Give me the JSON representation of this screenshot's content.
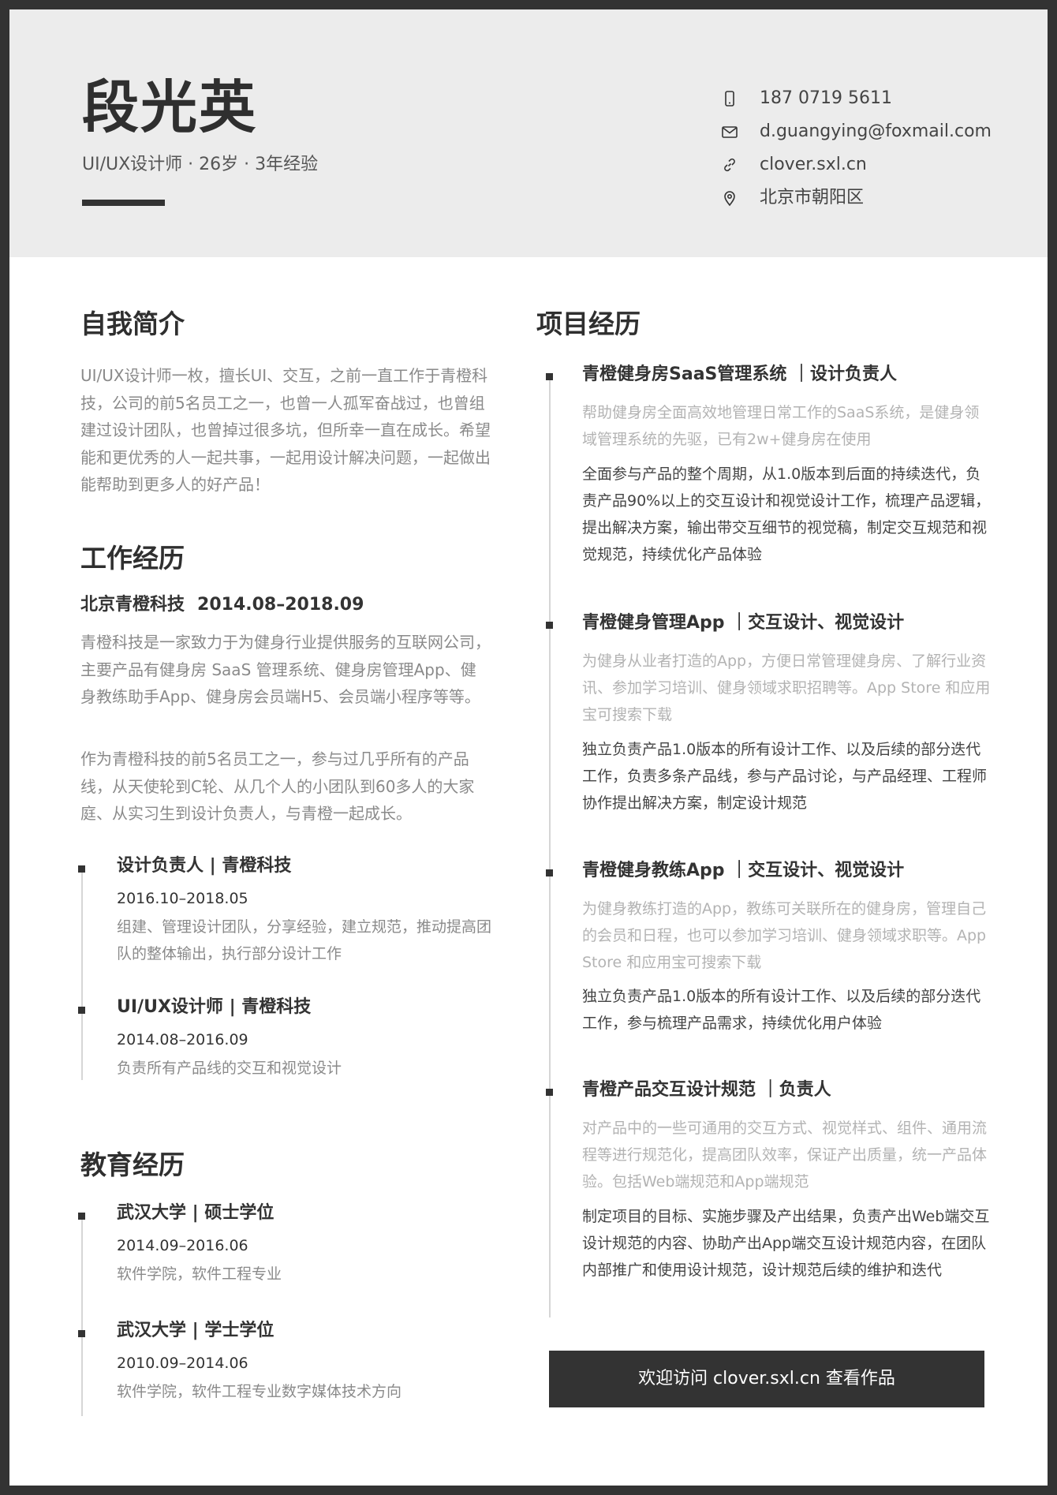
{
  "header": {
    "name": "段光英",
    "subtitle": "UI/UX设计师 · 26岁 · 3年经验",
    "contacts": [
      {
        "icon": "phone-icon",
        "text": "187 0719 5611"
      },
      {
        "icon": "mail-icon",
        "text": "d.guangying@foxmail.com"
      },
      {
        "icon": "link-icon",
        "text": "clover.sxl.cn"
      },
      {
        "icon": "location-icon",
        "text": "北京市朝阳区"
      }
    ]
  },
  "intro": {
    "title": "自我简介",
    "text": "UI/UX设计师一枚，擅长UI、交互，之前一直工作于青橙科技，公司的前5名员工之一，也曾一人孤军奋战过，也曾组建过设计团队，也曾掉过很多坑，但所幸一直在成长。希望能和更优秀的人一起共事，一起用设计解决问题，一起做出能帮助到更多人的好产品！"
  },
  "work": {
    "title": "工作经历",
    "company": "北京青橙科技",
    "period": "2014.08–2018.09",
    "para1": "青橙科技是一家致力于为健身行业提供服务的互联网公司，主要产品有健身房 SaaS 管理系统、健身房管理App、健身教练助手App、健身房会员端H5、会员端小程序等等。",
    "para2": "作为青橙科技的前5名员工之一，参与过几乎所有的产品线，从天使轮到C轮、从几个人的小团队到60多人的大家庭、从实习生到设计负责人，与青橙一起成长。",
    "items": [
      {
        "title": "设计负责人 | 青橙科技",
        "date": "2016.10–2018.05",
        "desc": "组建、管理设计团队，分享经验，建立规范，推动提高团队的整体输出，执行部分设计工作"
      },
      {
        "title": "UI/UX设计师 | 青橙科技",
        "date": "2014.08–2016.09",
        "desc": "负责所有产品线的交互和视觉设计"
      }
    ]
  },
  "education": {
    "title": "教育经历",
    "items": [
      {
        "title": "武汉大学 | 硕士学位",
        "date": "2014.09–2016.06",
        "desc": "软件学院，软件工程专业"
      },
      {
        "title": "武汉大学 | 学士学位",
        "date": "2010.09–2014.06",
        "desc": "软件学院，软件工程专业数字媒体技术方向"
      }
    ]
  },
  "projects": {
    "title": "项目经历",
    "items": [
      {
        "title": "青橙健身房SaaS管理系统 ｜设计负责人",
        "desc": "帮助健身房全面高效地管理日常工作的SaaS系统，是健身领域管理系统的先驱，已有2w+健身房在使用",
        "detail": "全面参与产品的整个周期，从1.0版本到后面的持续迭代，负责产品90%以上的交互设计和视觉设计工作，梳理产品逻辑，提出解决方案，输出带交互细节的视觉稿，制定交互规范和视觉规范，持续优化产品体验"
      },
      {
        "title": "青橙健身管理App ｜交互设计、视觉设计",
        "desc": "为健身从业者打造的App，方便日常管理健身房、了解行业资讯、参加学习培训、健身领域求职招聘等。App Store 和应用宝可搜索下载",
        "detail": "独立负责产品1.0版本的所有设计工作、以及后续的部分迭代工作，负责多条产品线，参与产品讨论，与产品经理、工程师协作提出解决方案，制定设计规范"
      },
      {
        "title": "青橙健身教练App ｜交互设计、视觉设计",
        "desc": "为健身教练打造的App，教练可关联所在的健身房，管理自己的会员和日程，也可以参加学习培训、健身领域求职等。App Store 和应用宝可搜索下载",
        "detail": "独立负责产品1.0版本的所有设计工作、以及后续的部分迭代工作，参与梳理产品需求，持续优化用户体验"
      },
      {
        "title": "青橙产品交互设计规范 ｜负责人",
        "desc": "对产品中的一些可通用的交互方式、视觉样式、组件、通用流程等进行规范化，提高团队效率，保证产出质量，统一产品体验。包括Web端规范和App端规范",
        "detail": "制定项目的目标、实施步骤及产出结果，负责产出Web端交互设计规范的内容、协助产出App端交互设计规范内容，在团队内部推广和使用设计规范，设计规范后续的维护和迭代"
      }
    ]
  },
  "footer": {
    "button_label": "欢迎访问 clover.sxl.cn 查看作品"
  }
}
